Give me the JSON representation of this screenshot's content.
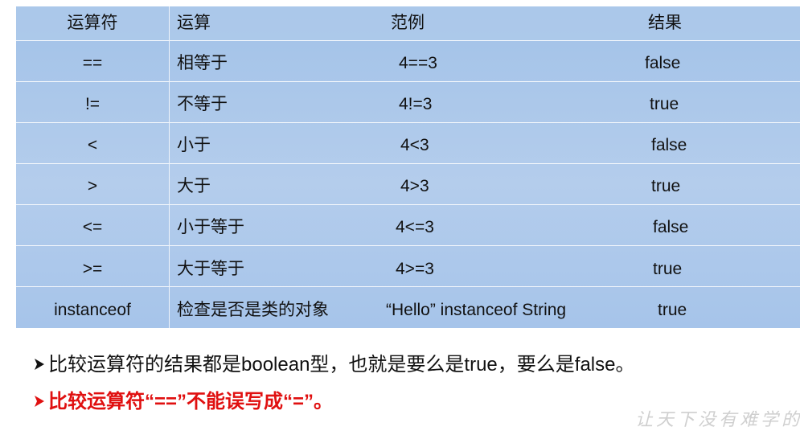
{
  "table": {
    "headers": [
      "运算符",
      "运算",
      "范例",
      "结果"
    ],
    "rows": [
      {
        "op": "==",
        "name": "相等于",
        "example": "4==3",
        "result": "false"
      },
      {
        "op": "!=",
        "name": "不等于",
        "example": "4!=3",
        "result": "true"
      },
      {
        "op": "<",
        "name": "小于",
        "example": "4<3",
        "result": "false"
      },
      {
        "op": ">",
        "name": "大于",
        "example": "4>3",
        "result": "true"
      },
      {
        "op": "<=",
        "name": "小于等于",
        "example": "4<=3",
        "result": "false"
      },
      {
        "op": ">=",
        "name": "大于等于",
        "example": "4>=3",
        "result": "true"
      },
      {
        "op": "instanceof",
        "name": "检查是否是类的对象",
        "example": "“Hello” instanceof  String",
        "result": "true"
      }
    ]
  },
  "notes": [
    "比较运算符的结果都是boolean型，也就是要么是true，要么是false。",
    "比较运算符“==”不能误写成“=”。"
  ],
  "watermark": "让天下没有难学的",
  "colors": {
    "table_bg": "#a6c4ea",
    "note_highlight": "#e01010"
  }
}
